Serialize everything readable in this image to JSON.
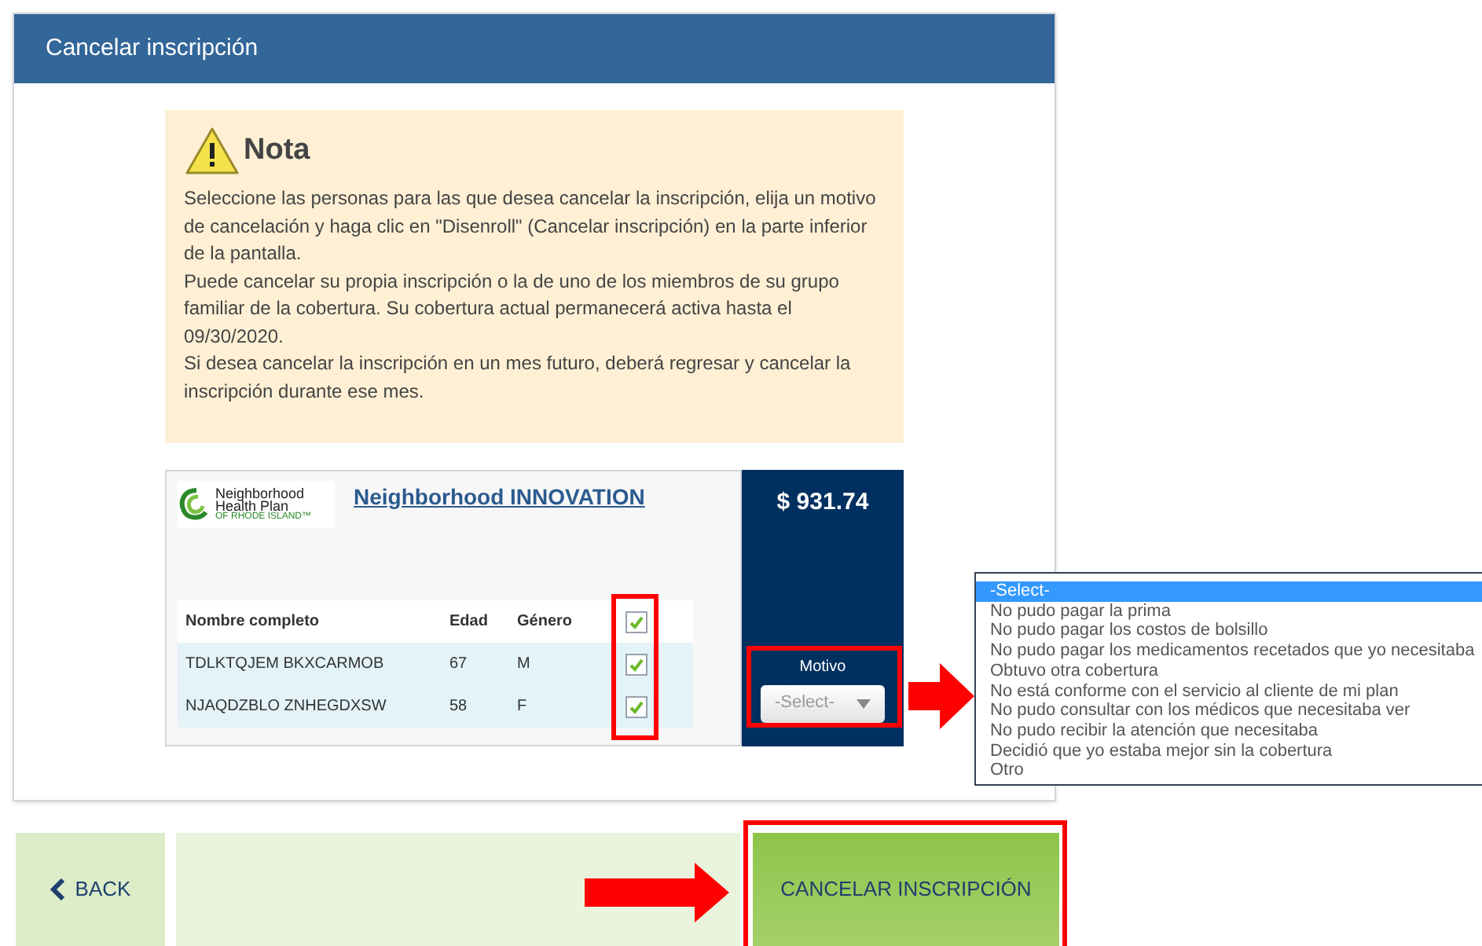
{
  "window": {
    "title": "Cancelar inscripción"
  },
  "note": {
    "title": "Nota",
    "paragraphs": [
      "Seleccione las personas para las que desea cancelar la inscripción, elija un motivo de cancelación y haga clic en \"Disenroll\" (Cancelar inscripción) en la parte inferior de la pantalla.",
      "Puede cancelar su propia inscripción o la de uno de los miembros de su grupo familiar de la cobertura. Su cobertura actual permanecerá activa hasta el 09/30/2020.",
      "Si desea cancelar la inscripción en un mes futuro, deberá regresar y cancelar la inscripción durante ese mes."
    ]
  },
  "plan": {
    "logo_lines": [
      "Neighborhood",
      "Health Plan",
      "OF RHODE ISLAND™"
    ],
    "name": "Neighborhood INNOVATION",
    "price": "$ 931.74",
    "table": {
      "columns": [
        "Nombre completo",
        "Edad",
        "Género"
      ],
      "select_all_checked": true,
      "rows": [
        {
          "name": "TDLKTQJEM BKXCARMOB",
          "age": "67",
          "gender": "M",
          "checked": true
        },
        {
          "name": "NJAQDZBLO ZNHEGDXSW",
          "age": "58",
          "gender": "F",
          "checked": true
        }
      ]
    },
    "reason": {
      "label": "Motivo",
      "value": "-Select-"
    }
  },
  "reason_options": [
    {
      "label": "-Select-",
      "selected": true
    },
    {
      "label": "No pudo pagar la prima",
      "selected": false
    },
    {
      "label": "No pudo pagar los costos de bolsillo",
      "selected": false
    },
    {
      "label": "No pudo pagar los medicamentos recetados que yo necesitaba",
      "selected": false
    },
    {
      "label": "Obtuvo otra cobertura",
      "selected": false
    },
    {
      "label": "No está conforme con el servicio al cliente de mi plan",
      "selected": false
    },
    {
      "label": "No pudo consultar con los médicos que necesitaba ver",
      "selected": false
    },
    {
      "label": "No pudo recibir la atención que necesitaba",
      "selected": false
    },
    {
      "label": "Decidió que yo estaba mejor sin la cobertura",
      "selected": false
    },
    {
      "label": "Otro",
      "selected": false
    }
  ],
  "footer": {
    "back": "BACK",
    "submit": "CANCELAR INSCRIPCIÓN"
  }
}
